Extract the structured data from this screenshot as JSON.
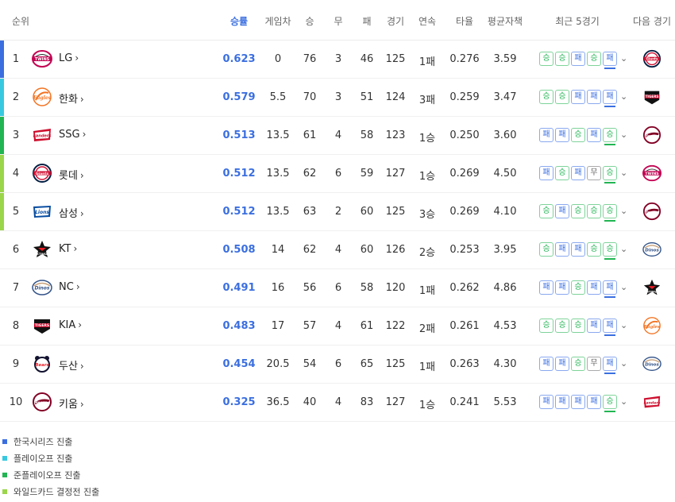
{
  "header": {
    "rank": "순위",
    "pct": "승률",
    "gb": "게임차",
    "w": "승",
    "d": "무",
    "l": "패",
    "g": "경기",
    "streak": "연속",
    "avg": "타율",
    "era": "평균자책",
    "recent": "최근 5경기",
    "next": "다음 경기"
  },
  "colors": {
    "ks": "#3b6fe0",
    "po": "#38c9e0",
    "jpo": "#22b553",
    "wc": "#9bd64a",
    "win": "#22b553",
    "loss": "#3b6fe0",
    "draw": "#666666"
  },
  "rows": [
    {
      "rank": "1",
      "team": "LG",
      "pct": "0.623",
      "gb": "0",
      "w": "76",
      "d": "3",
      "l": "46",
      "g": "125",
      "streak": "1패",
      "avg": "0.276",
      "era": "3.59",
      "recent": [
        "승",
        "승",
        "패",
        "승",
        "패"
      ],
      "tier": "ks",
      "logo": "twins-logo",
      "next": "giants-logo"
    },
    {
      "rank": "2",
      "team": "한화",
      "pct": "0.579",
      "gb": "5.5",
      "w": "70",
      "d": "3",
      "l": "51",
      "g": "124",
      "streak": "3패",
      "avg": "0.259",
      "era": "3.47",
      "recent": [
        "승",
        "승",
        "패",
        "패",
        "패"
      ],
      "tier": "po",
      "logo": "eagles-logo",
      "next": "tigers-logo"
    },
    {
      "rank": "3",
      "team": "SSG",
      "pct": "0.513",
      "gb": "13.5",
      "w": "61",
      "d": "4",
      "l": "58",
      "g": "123",
      "streak": "1승",
      "avg": "0.250",
      "era": "3.60",
      "recent": [
        "패",
        "패",
        "승",
        "패",
        "승"
      ],
      "tier": "jpo",
      "logo": "landers-logo",
      "next": "heroes-logo"
    },
    {
      "rank": "4",
      "team": "롯데",
      "pct": "0.512",
      "gb": "13.5",
      "w": "62",
      "d": "6",
      "l": "59",
      "g": "127",
      "streak": "1승",
      "avg": "0.269",
      "era": "4.50",
      "recent": [
        "패",
        "승",
        "패",
        "무",
        "승"
      ],
      "tier": "wc",
      "logo": "giants-logo",
      "next": "twins-logo"
    },
    {
      "rank": "5",
      "team": "삼성",
      "pct": "0.512",
      "gb": "13.5",
      "w": "63",
      "d": "2",
      "l": "60",
      "g": "125",
      "streak": "3승",
      "avg": "0.269",
      "era": "4.10",
      "recent": [
        "승",
        "패",
        "승",
        "승",
        "승"
      ],
      "tier": "wc",
      "logo": "lions-logo",
      "next": "heroes-logo"
    },
    {
      "rank": "6",
      "team": "KT",
      "pct": "0.508",
      "gb": "14",
      "w": "62",
      "d": "4",
      "l": "60",
      "g": "126",
      "streak": "2승",
      "avg": "0.253",
      "era": "3.95",
      "recent": [
        "승",
        "패",
        "패",
        "승",
        "승"
      ],
      "tier": "",
      "logo": "ktwiz-logo",
      "next": "dinos-logo"
    },
    {
      "rank": "7",
      "team": "NC",
      "pct": "0.491",
      "gb": "16",
      "w": "56",
      "d": "6",
      "l": "58",
      "g": "120",
      "streak": "1패",
      "avg": "0.262",
      "era": "4.86",
      "recent": [
        "패",
        "패",
        "승",
        "패",
        "패"
      ],
      "tier": "",
      "logo": "dinos-logo",
      "next": "ktwiz-logo"
    },
    {
      "rank": "8",
      "team": "KIA",
      "pct": "0.483",
      "gb": "17",
      "w": "57",
      "d": "4",
      "l": "61",
      "g": "122",
      "streak": "2패",
      "avg": "0.261",
      "era": "4.53",
      "recent": [
        "승",
        "승",
        "승",
        "패",
        "패"
      ],
      "tier": "",
      "logo": "tigers-logo",
      "next": "eagles-logo"
    },
    {
      "rank": "9",
      "team": "두산",
      "pct": "0.454",
      "gb": "20.5",
      "w": "54",
      "d": "6",
      "l": "65",
      "g": "125",
      "streak": "1패",
      "avg": "0.263",
      "era": "4.30",
      "recent": [
        "패",
        "패",
        "승",
        "무",
        "패"
      ],
      "tier": "",
      "logo": "bears-logo",
      "next": "dinos-logo"
    },
    {
      "rank": "10",
      "team": "키움",
      "pct": "0.325",
      "gb": "36.5",
      "w": "40",
      "d": "4",
      "l": "83",
      "g": "127",
      "streak": "1승",
      "avg": "0.241",
      "era": "5.53",
      "recent": [
        "패",
        "패",
        "패",
        "패",
        "승"
      ],
      "tier": "",
      "logo": "heroes-logo",
      "next": "landers-logo"
    }
  ],
  "legend": [
    {
      "label": "한국시리즈 진출",
      "color": "#3b6fe0"
    },
    {
      "label": "플레이오프 진출",
      "color": "#38c9e0"
    },
    {
      "label": "준플레이오프 진출",
      "color": "#22b553"
    },
    {
      "label": "와일드카드 결정전 진출",
      "color": "#9bd64a"
    }
  ]
}
